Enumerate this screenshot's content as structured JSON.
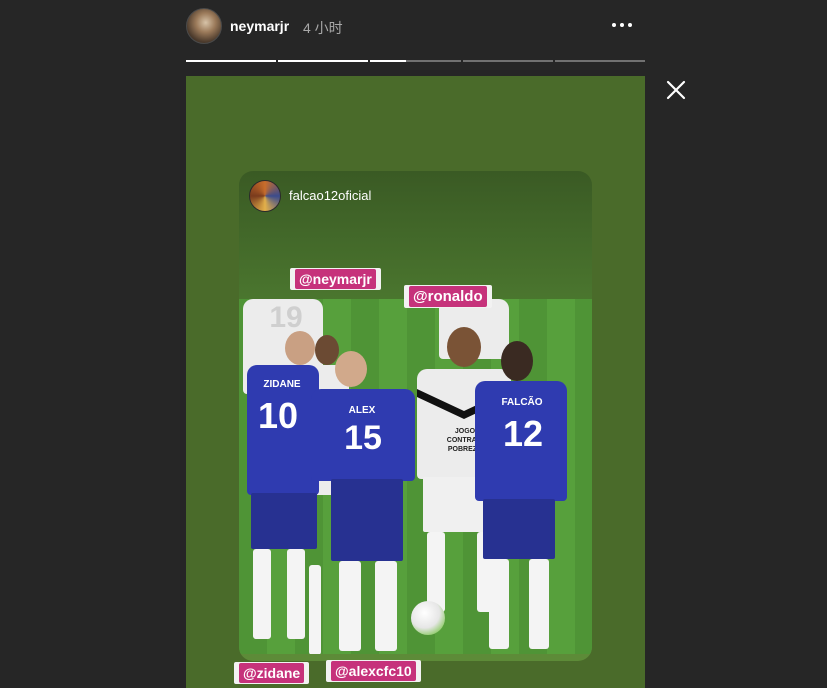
{
  "header": {
    "username": "neymarjr",
    "time": "4 小时"
  },
  "progress": {
    "segments": [
      1,
      1,
      0.4,
      0,
      0
    ]
  },
  "story": {
    "card_user": "falcao12oficial",
    "mentions": [
      "@neymarjr",
      "@ronaldo",
      "@zidane",
      "@alexcfc10"
    ],
    "players": {
      "p10": {
        "name": "ZIDANE",
        "number": "10"
      },
      "p15": {
        "name": "ALEX",
        "number": "15"
      },
      "p12": {
        "name": "FALCÃO",
        "number": "12"
      },
      "p19": {
        "number": "19"
      },
      "ronaldo_shirt": "JOGO CONTRA A POBREZA"
    }
  },
  "colors": {
    "background": "#262626",
    "story_bg": "#4a6b2a",
    "mention_pink": "#c6327b",
    "blue_kit": "#2f3bb0"
  }
}
